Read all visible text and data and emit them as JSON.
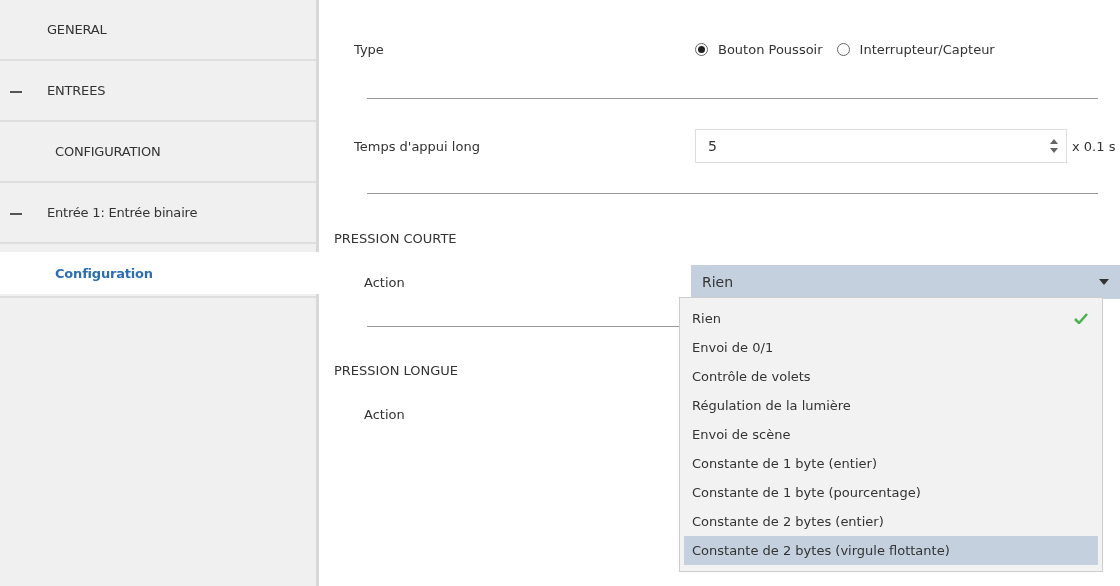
{
  "sidebar": {
    "items": [
      {
        "label": "GENERAL",
        "selected": false
      },
      {
        "label": "ENTREES",
        "selected": false,
        "expanded": true,
        "children": [
          {
            "label": "CONFIGURATION",
            "selected": false
          },
          {
            "label": "Entrée 1: Entrée binaire",
            "selected": false,
            "expanded": true,
            "children": [
              {
                "label": "Configuration",
                "selected": true
              }
            ]
          }
        ]
      }
    ]
  },
  "main": {
    "type_row": {
      "label": "Type",
      "options": [
        {
          "label": "Bouton Poussoir",
          "selected": true
        },
        {
          "label": "Interrupteur/Capteur",
          "selected": false
        }
      ]
    },
    "long_press_time": {
      "label": "Temps d'appui long",
      "value": "5",
      "unit": "x 0.1 s"
    },
    "sections": [
      {
        "title": "PRESSION COURTE",
        "action_label": "Action",
        "value": "Rien",
        "open": true,
        "options": [
          {
            "label": "Rien",
            "selected": true,
            "highlighted": false
          },
          {
            "label": "Envoi de 0/1",
            "selected": false,
            "highlighted": false
          },
          {
            "label": "Contrôle de volets",
            "selected": false,
            "highlighted": false
          },
          {
            "label": "Régulation de la lumière",
            "selected": false,
            "highlighted": false
          },
          {
            "label": "Envoi de scène",
            "selected": false,
            "highlighted": false
          },
          {
            "label": "Constante de 1 byte (entier)",
            "selected": false,
            "highlighted": false
          },
          {
            "label": "Constante de 1 byte (pourcentage)",
            "selected": false,
            "highlighted": false
          },
          {
            "label": "Constante de 2 bytes (entier)",
            "selected": false,
            "highlighted": false
          },
          {
            "label": "Constante de 2 bytes (virgule flottante)",
            "selected": false,
            "highlighted": true
          }
        ]
      },
      {
        "title": "PRESSION LONGUE",
        "action_label": "Action"
      }
    ]
  }
}
